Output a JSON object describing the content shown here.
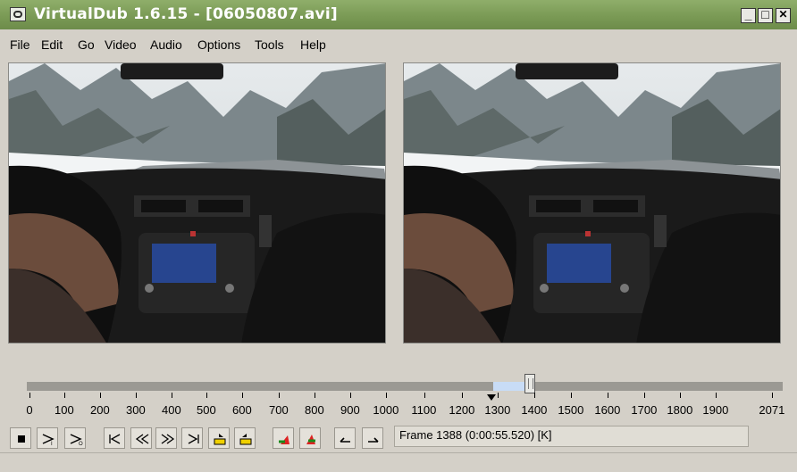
{
  "window": {
    "title": "VirtualDub 1.6.15 - [06050807.avi]",
    "minimize": "_",
    "maximize": "□",
    "close": "✕"
  },
  "menu": [
    "File",
    "Edit",
    "Go",
    "Video",
    "Audio",
    "Options",
    "Tools",
    "Help"
  ],
  "timeline": {
    "labels": [
      "0",
      "100",
      "200",
      "300",
      "400",
      "500",
      "600",
      "700",
      "800",
      "900",
      "1000",
      "1100",
      "1200",
      "1300",
      "1400",
      "1500",
      "1600",
      "1700",
      "1800",
      "1900",
      "2071"
    ],
    "current_frame": 1388,
    "total_frames": 2071
  },
  "toolbar": {
    "buttons": [
      "stop-icon",
      "play-input-icon",
      "play-output-icon",
      "go-start-icon",
      "prev-frame-icon",
      "next-frame-icon",
      "go-end-icon",
      "prev-key-icon",
      "next-key-icon",
      "prev-scene-icon",
      "next-scene-icon",
      "mark-in-icon",
      "mark-out-icon"
    ]
  },
  "frame_info": "Frame 1388 (0:00:55.520) [K]",
  "colors": {
    "titlebar": "#7a9a55",
    "face": "#d4d0c8",
    "selection": "#c8dcf6"
  }
}
